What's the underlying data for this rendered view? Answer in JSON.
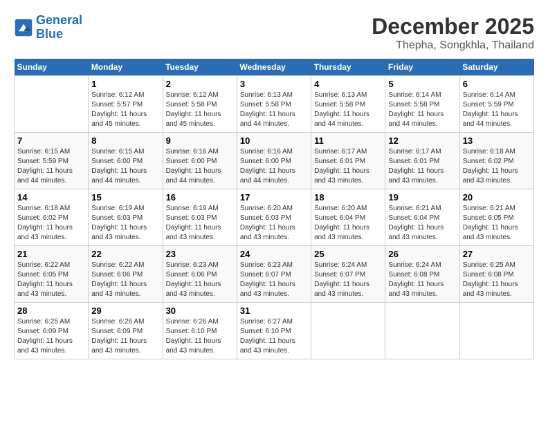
{
  "header": {
    "logo_line1": "General",
    "logo_line2": "Blue",
    "month": "December 2025",
    "location": "Thepha, Songkhla, Thailand"
  },
  "days_of_week": [
    "Sunday",
    "Monday",
    "Tuesday",
    "Wednesday",
    "Thursday",
    "Friday",
    "Saturday"
  ],
  "weeks": [
    [
      {
        "day": "",
        "sunrise": "",
        "sunset": "",
        "daylight": ""
      },
      {
        "day": "1",
        "sunrise": "Sunrise: 6:12 AM",
        "sunset": "Sunset: 5:57 PM",
        "daylight": "Daylight: 11 hours and 45 minutes."
      },
      {
        "day": "2",
        "sunrise": "Sunrise: 6:12 AM",
        "sunset": "Sunset: 5:58 PM",
        "daylight": "Daylight: 11 hours and 45 minutes."
      },
      {
        "day": "3",
        "sunrise": "Sunrise: 6:13 AM",
        "sunset": "Sunset: 5:58 PM",
        "daylight": "Daylight: 11 hours and 44 minutes."
      },
      {
        "day": "4",
        "sunrise": "Sunrise: 6:13 AM",
        "sunset": "Sunset: 5:58 PM",
        "daylight": "Daylight: 11 hours and 44 minutes."
      },
      {
        "day": "5",
        "sunrise": "Sunrise: 6:14 AM",
        "sunset": "Sunset: 5:58 PM",
        "daylight": "Daylight: 11 hours and 44 minutes."
      },
      {
        "day": "6",
        "sunrise": "Sunrise: 6:14 AM",
        "sunset": "Sunset: 5:59 PM",
        "daylight": "Daylight: 11 hours and 44 minutes."
      }
    ],
    [
      {
        "day": "7",
        "sunrise": "Sunrise: 6:15 AM",
        "sunset": "Sunset: 5:59 PM",
        "daylight": "Daylight: 11 hours and 44 minutes."
      },
      {
        "day": "8",
        "sunrise": "Sunrise: 6:15 AM",
        "sunset": "Sunset: 6:00 PM",
        "daylight": "Daylight: 11 hours and 44 minutes."
      },
      {
        "day": "9",
        "sunrise": "Sunrise: 6:16 AM",
        "sunset": "Sunset: 6:00 PM",
        "daylight": "Daylight: 11 hours and 44 minutes."
      },
      {
        "day": "10",
        "sunrise": "Sunrise: 6:16 AM",
        "sunset": "Sunset: 6:00 PM",
        "daylight": "Daylight: 11 hours and 44 minutes."
      },
      {
        "day": "11",
        "sunrise": "Sunrise: 6:17 AM",
        "sunset": "Sunset: 6:01 PM",
        "daylight": "Daylight: 11 hours and 43 minutes."
      },
      {
        "day": "12",
        "sunrise": "Sunrise: 6:17 AM",
        "sunset": "Sunset: 6:01 PM",
        "daylight": "Daylight: 11 hours and 43 minutes."
      },
      {
        "day": "13",
        "sunrise": "Sunrise: 6:18 AM",
        "sunset": "Sunset: 6:02 PM",
        "daylight": "Daylight: 11 hours and 43 minutes."
      }
    ],
    [
      {
        "day": "14",
        "sunrise": "Sunrise: 6:18 AM",
        "sunset": "Sunset: 6:02 PM",
        "daylight": "Daylight: 11 hours and 43 minutes."
      },
      {
        "day": "15",
        "sunrise": "Sunrise: 6:19 AM",
        "sunset": "Sunset: 6:03 PM",
        "daylight": "Daylight: 11 hours and 43 minutes."
      },
      {
        "day": "16",
        "sunrise": "Sunrise: 6:19 AM",
        "sunset": "Sunset: 6:03 PM",
        "daylight": "Daylight: 11 hours and 43 minutes."
      },
      {
        "day": "17",
        "sunrise": "Sunrise: 6:20 AM",
        "sunset": "Sunset: 6:03 PM",
        "daylight": "Daylight: 11 hours and 43 minutes."
      },
      {
        "day": "18",
        "sunrise": "Sunrise: 6:20 AM",
        "sunset": "Sunset: 6:04 PM",
        "daylight": "Daylight: 11 hours and 43 minutes."
      },
      {
        "day": "19",
        "sunrise": "Sunrise: 6:21 AM",
        "sunset": "Sunset: 6:04 PM",
        "daylight": "Daylight: 11 hours and 43 minutes."
      },
      {
        "day": "20",
        "sunrise": "Sunrise: 6:21 AM",
        "sunset": "Sunset: 6:05 PM",
        "daylight": "Daylight: 11 hours and 43 minutes."
      }
    ],
    [
      {
        "day": "21",
        "sunrise": "Sunrise: 6:22 AM",
        "sunset": "Sunset: 6:05 PM",
        "daylight": "Daylight: 11 hours and 43 minutes."
      },
      {
        "day": "22",
        "sunrise": "Sunrise: 6:22 AM",
        "sunset": "Sunset: 6:06 PM",
        "daylight": "Daylight: 11 hours and 43 minutes."
      },
      {
        "day": "23",
        "sunrise": "Sunrise: 6:23 AM",
        "sunset": "Sunset: 6:06 PM",
        "daylight": "Daylight: 11 hours and 43 minutes."
      },
      {
        "day": "24",
        "sunrise": "Sunrise: 6:23 AM",
        "sunset": "Sunset: 6:07 PM",
        "daylight": "Daylight: 11 hours and 43 minutes."
      },
      {
        "day": "25",
        "sunrise": "Sunrise: 6:24 AM",
        "sunset": "Sunset: 6:07 PM",
        "daylight": "Daylight: 11 hours and 43 minutes."
      },
      {
        "day": "26",
        "sunrise": "Sunrise: 6:24 AM",
        "sunset": "Sunset: 6:08 PM",
        "daylight": "Daylight: 11 hours and 43 minutes."
      },
      {
        "day": "27",
        "sunrise": "Sunrise: 6:25 AM",
        "sunset": "Sunset: 6:08 PM",
        "daylight": "Daylight: 11 hours and 43 minutes."
      }
    ],
    [
      {
        "day": "28",
        "sunrise": "Sunrise: 6:25 AM",
        "sunset": "Sunset: 6:09 PM",
        "daylight": "Daylight: 11 hours and 43 minutes."
      },
      {
        "day": "29",
        "sunrise": "Sunrise: 6:26 AM",
        "sunset": "Sunset: 6:09 PM",
        "daylight": "Daylight: 11 hours and 43 minutes."
      },
      {
        "day": "30",
        "sunrise": "Sunrise: 6:26 AM",
        "sunset": "Sunset: 6:10 PM",
        "daylight": "Daylight: 11 hours and 43 minutes."
      },
      {
        "day": "31",
        "sunrise": "Sunrise: 6:27 AM",
        "sunset": "Sunset: 6:10 PM",
        "daylight": "Daylight: 11 hours and 43 minutes."
      },
      {
        "day": "",
        "sunrise": "",
        "sunset": "",
        "daylight": ""
      },
      {
        "day": "",
        "sunrise": "",
        "sunset": "",
        "daylight": ""
      },
      {
        "day": "",
        "sunrise": "",
        "sunset": "",
        "daylight": ""
      }
    ]
  ]
}
